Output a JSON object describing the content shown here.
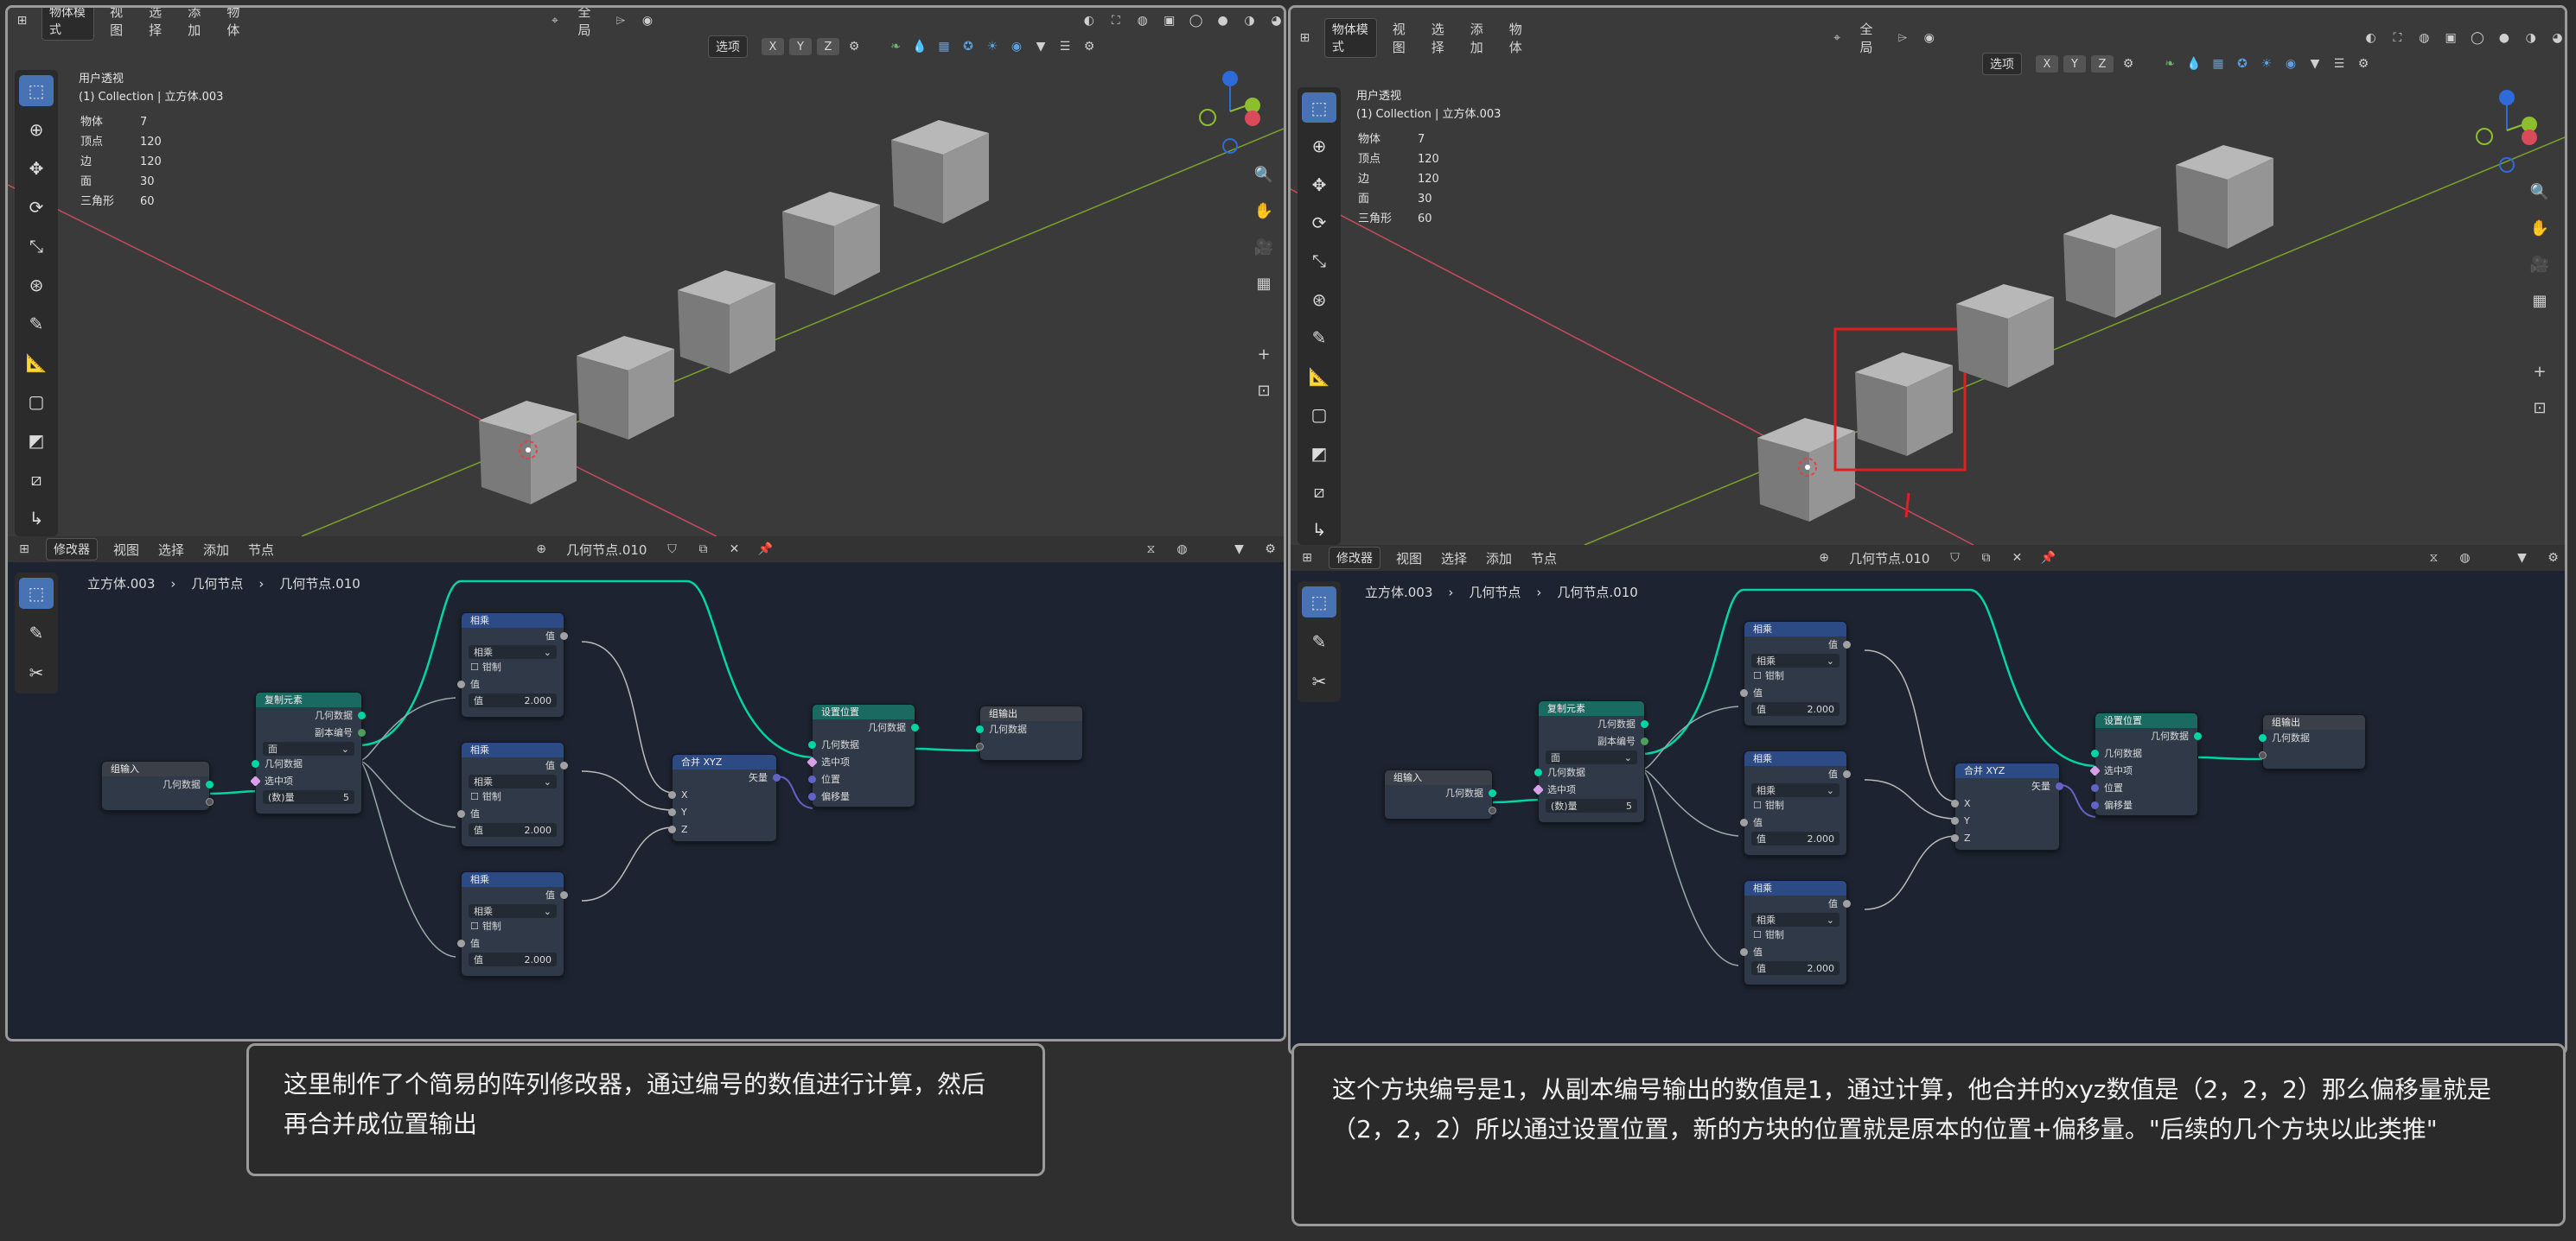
{
  "left_window": {
    "header": {
      "mode": "物体模式",
      "menus": [
        "视图",
        "选择",
        "添加",
        "物体"
      ],
      "global": "全局",
      "select_label": "选项",
      "axes": [
        "X",
        "Y",
        "Z"
      ]
    },
    "overlay": {
      "view_name": "用户透视",
      "collection": "(1) Collection | 立方体.003",
      "stats": [
        {
          "label": "物体",
          "value": "7"
        },
        {
          "label": "顶点",
          "value": "120"
        },
        {
          "label": "边",
          "value": "120"
        },
        {
          "label": "面",
          "value": "30"
        },
        {
          "label": "三角形",
          "value": "60"
        }
      ]
    },
    "node_editor": {
      "type": "修改器",
      "menus": [
        "视图",
        "选择",
        "添加",
        "节点"
      ],
      "tree_name": "几何节点.010",
      "breadcrumb": [
        "立方体.003",
        "几何节点",
        "几何节点.010"
      ]
    }
  },
  "right_window": {
    "header": {
      "mode": "物体模式",
      "menus": [
        "视图",
        "选择",
        "添加",
        "物体"
      ],
      "global": "全局",
      "select_label": "选项",
      "axes": [
        "X",
        "Y",
        "Z"
      ]
    },
    "overlay": {
      "view_name": "用户透视",
      "collection": "(1) Collection | 立方体.003",
      "stats": [
        {
          "label": "物体",
          "value": "7"
        },
        {
          "label": "顶点",
          "value": "120"
        },
        {
          "label": "边",
          "value": "120"
        },
        {
          "label": "面",
          "value": "30"
        },
        {
          "label": "三角形",
          "value": "60"
        }
      ]
    },
    "node_editor": {
      "type": "修改器",
      "menus": [
        "视图",
        "选择",
        "添加",
        "节点"
      ],
      "tree_name": "几何节点.010",
      "breadcrumb": [
        "立方体.003",
        "几何节点",
        "几何节点.010"
      ]
    },
    "highlight_color": "#e02020"
  },
  "nodes": {
    "group_input": {
      "title": "组输入",
      "out": "几何数据"
    },
    "instance": {
      "title": "复制元素",
      "out1": "几何数据",
      "out2": "副本编号",
      "mode": "面",
      "in1": "几何数据",
      "in2": "选中项",
      "count_label": "(数)量",
      "count_value": "5"
    },
    "math1": {
      "title": "相乘",
      "out": "值",
      "op": "相乘",
      "clamp": "钳制",
      "in1": "值",
      "in2_label": "值",
      "in2_value": "2.000"
    },
    "math2": {
      "title": "相乘",
      "out": "值",
      "op": "相乘",
      "clamp": "钳制",
      "in1": "值",
      "in2_label": "值",
      "in2_value": "2.000"
    },
    "math3": {
      "title": "相乘",
      "out": "值",
      "op": "相乘",
      "clamp": "钳制",
      "in1": "值",
      "in2_label": "值",
      "in2_value": "2.000"
    },
    "combine": {
      "title": "合并 XYZ",
      "out": "矢量",
      "x": "X",
      "y": "Y",
      "z": "Z"
    },
    "set_position": {
      "title": "设置位置",
      "out": "几何数据",
      "in1": "几何数据",
      "in2": "选中项",
      "in3": "位置",
      "in4": "偏移量"
    },
    "group_output": {
      "title": "组输出",
      "in": "几何数据"
    }
  },
  "right_nodes_extra": {
    "instance_out2": "副本编号"
  },
  "captions": {
    "left": "这里制作了个简易的阵列修改器，通过编号的数值进行计算，然后再合并成位置输出",
    "right": "这个方块编号是1，从副本编号输出的数值是1，通过计算，他合并的xyz数值是（2，2，2）那么偏移量就是（2，2，2）所以通过设置位置，新的方块的位置就是原本的位置+偏移量。\"后续的几个方块以此类推\""
  },
  "colors": {
    "accent": "#4772b3",
    "node_link_geo": "#00d6a3",
    "x_axis": "#c84b5c",
    "y_axis": "#7aa32b"
  }
}
